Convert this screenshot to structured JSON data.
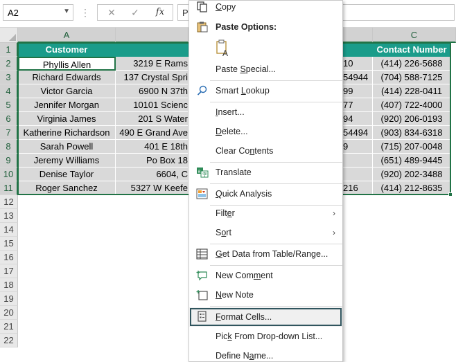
{
  "formula_bar": {
    "name_box": "A2",
    "cancel_glyph": "✕",
    "enter_glyph": "✓",
    "fx_label": "fx",
    "formula_value": "P"
  },
  "grid": {
    "columns": [
      "A",
      "C"
    ],
    "rows": [
      "1",
      "2",
      "3",
      "4",
      "5",
      "6",
      "7",
      "8",
      "9",
      "10",
      "11",
      "12",
      "13",
      "14",
      "15",
      "16",
      "17",
      "18",
      "19",
      "20",
      "21",
      "22"
    ],
    "header_row": {
      "a": "Customer",
      "c": "Contact Number"
    },
    "data": [
      {
        "a": "Phyllis Allen",
        "b": "3219 E Rams",
        "d": "10",
        "c": "(414) 226-5688"
      },
      {
        "a": "Richard Edwards",
        "b": "137 Crystal Spri",
        "d": "54944",
        "c": "(704) 588-7125"
      },
      {
        "a": "Victor Garcia",
        "b": "6900 N 37th",
        "d": "99",
        "c": "(414) 228-0411"
      },
      {
        "a": "Jennifer Morgan",
        "b": "10101 Scienc",
        "d": "77",
        "c": "(407) 722-4000"
      },
      {
        "a": "Virginia James",
        "b": "201 S Water",
        "d": "94",
        "c": "(920) 206-0193"
      },
      {
        "a": "Katherine Richardson",
        "b": "490 E Grand Ave",
        "d": "54494",
        "c": "(903) 834-6318"
      },
      {
        "a": "Sarah Powell",
        "b": "401 E 18th",
        "d": "9",
        "c": "(715) 207-0048"
      },
      {
        "a": "Jeremy Williams",
        "b": "Po Box 18",
        "d": "",
        "c": "(651) 489-9445"
      },
      {
        "a": "Denise Taylor",
        "b": "6604, C",
        "d": "",
        "c": "(920) 202-3488"
      },
      {
        "a": "Roger Sanchez",
        "b": "5327 W Keefe",
        "d": "216",
        "c": "(414) 212-8635"
      }
    ]
  },
  "context_menu": {
    "copy": {
      "pre": "",
      "key": "C",
      "post": "opy"
    },
    "paste_options": "Paste Options:",
    "paste_icon_letter": "A",
    "paste_special": {
      "pre": "Paste ",
      "key": "S",
      "post": "pecial..."
    },
    "smart_lookup": {
      "pre": "Smart ",
      "key": "L",
      "post": "ookup"
    },
    "insert": {
      "pre": "",
      "key": "I",
      "post": "nsert..."
    },
    "delete": {
      "pre": "",
      "key": "D",
      "post": "elete..."
    },
    "clear_contents": {
      "pre": "Clear Co",
      "key": "n",
      "post": "tents"
    },
    "translate": "Translate",
    "quick_analysis": {
      "pre": "",
      "key": "Q",
      "post": "uick Analysis"
    },
    "filter": {
      "pre": "Filt",
      "key": "e",
      "post": "r"
    },
    "sort": {
      "pre": "S",
      "key": "o",
      "post": "rt"
    },
    "get_data": {
      "pre": "",
      "key": "G",
      "post": "et Data from Table/Range..."
    },
    "new_comment": {
      "pre": "New Com",
      "key": "m",
      "post": "ent"
    },
    "new_note": {
      "pre": "",
      "key": "N",
      "post": "ew Note"
    },
    "format_cells": {
      "pre": "",
      "key": "F",
      "post": "ormat Cells..."
    },
    "pick_from_list": {
      "pre": "Pic",
      "key": "k",
      "post": " From Drop-down List..."
    },
    "define_name": {
      "pre": "Define N",
      "key": "a",
      "post": "me..."
    },
    "submenu_arrow": "›"
  },
  "colors": {
    "header_fill": "#1a9c8a",
    "data_fill": "#d9d9d9",
    "selection": "#217346",
    "highlight_outline": "#30555e"
  }
}
